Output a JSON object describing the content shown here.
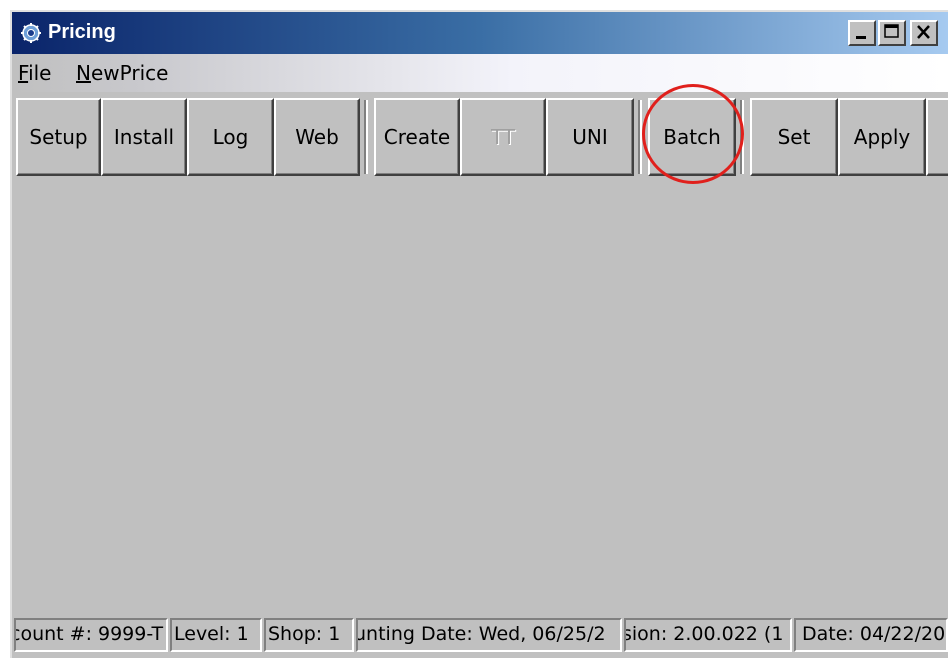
{
  "window": {
    "title": "Pricing"
  },
  "menu": {
    "items": [
      {
        "label": "File",
        "mnemonic": "F",
        "rest": "ile"
      },
      {
        "label": "NewPrice",
        "mnemonic": "N",
        "rest": "ewPrice"
      }
    ]
  },
  "toolbar": {
    "buttons": [
      {
        "label": "Setup",
        "enabled": true
      },
      {
        "label": "Install",
        "enabled": true
      },
      {
        "label": "Log",
        "enabled": true
      },
      {
        "label": "Web",
        "enabled": true
      },
      {
        "label": "Create",
        "enabled": true
      },
      {
        "label": "TT",
        "enabled": false
      },
      {
        "label": "UNI",
        "enabled": true
      },
      {
        "label": "Batch",
        "enabled": true,
        "highlighted": true
      },
      {
        "label": "Set",
        "enabled": true
      },
      {
        "label": "Apply",
        "enabled": true
      }
    ],
    "highlight_color": "#e0201c"
  },
  "statusbar": {
    "cells": [
      {
        "text": "count #: 9999-T"
      },
      {
        "text": "Level: 1"
      },
      {
        "text": "Shop: 1"
      },
      {
        "text": "unting Date: Wed, 06/25/2"
      },
      {
        "text": "sion: 2.00.022  (1"
      },
      {
        "text": "Date: 04/22/20"
      }
    ]
  },
  "icons": {
    "app_icon": "gear-globe-icon",
    "minimize": "minimize-icon",
    "maximize": "maximize-icon",
    "close": "close-icon"
  }
}
